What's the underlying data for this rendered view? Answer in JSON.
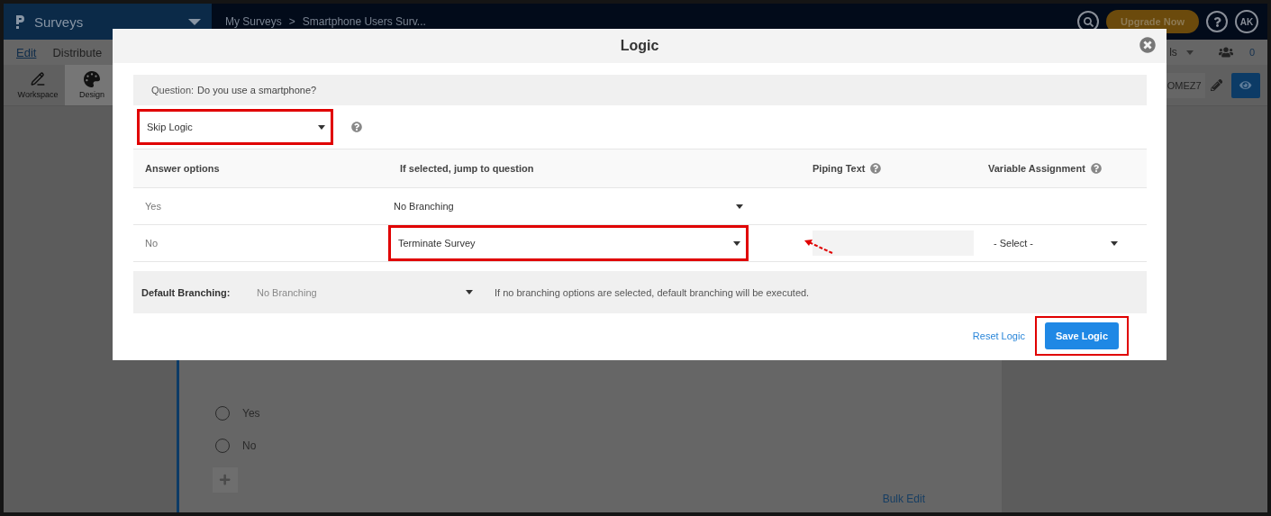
{
  "app": {
    "product": "Surveys",
    "breadcrumb": [
      "My Surveys",
      "Smartphone Users Surv..."
    ],
    "breadcrumb_separator": ">",
    "upgrade": "Upgrade Now",
    "avatar": "AK",
    "menu": [
      {
        "label": "Edit",
        "selected": true
      },
      {
        "label": "Distribute",
        "selected": false
      }
    ],
    "menu_right": "ls",
    "collaborators": "0",
    "tools": [
      {
        "label": "Workspace",
        "selected": false
      },
      {
        "label": "Design",
        "selected": true
      }
    ],
    "survey_code": "OMEZ7"
  },
  "survey_card": {
    "options": [
      {
        "label": "Yes",
        "selected": false
      },
      {
        "label": "No",
        "selected": false
      }
    ],
    "bulk_edit": "Bulk Edit"
  },
  "modal": {
    "title": "Logic",
    "question_label": "Question:",
    "question": "Do you use a smartphone?",
    "logic_type": {
      "value": "Skip Logic",
      "highlighted": true
    },
    "columns": [
      {
        "label": "Answer options",
        "help": false
      },
      {
        "label": "If selected, jump to question",
        "help": false
      },
      {
        "label": "Piping Text",
        "help": true
      },
      {
        "label": "Variable Assignment",
        "help": true
      }
    ],
    "rows": [
      {
        "answer": "Yes",
        "jump": "No Branching",
        "highlighted": false,
        "piping_field": false
      },
      {
        "answer": "No",
        "jump": "Terminate Survey",
        "highlighted": true,
        "piping_field": true,
        "variable": "- Select -"
      }
    ],
    "default_branching": {
      "label": "Default Branching:",
      "value": "No Branching",
      "note": "If no branching options are selected, default branching will be executed."
    },
    "reset": "Reset Logic",
    "save": {
      "label": "Save Logic",
      "highlighted": true
    }
  }
}
